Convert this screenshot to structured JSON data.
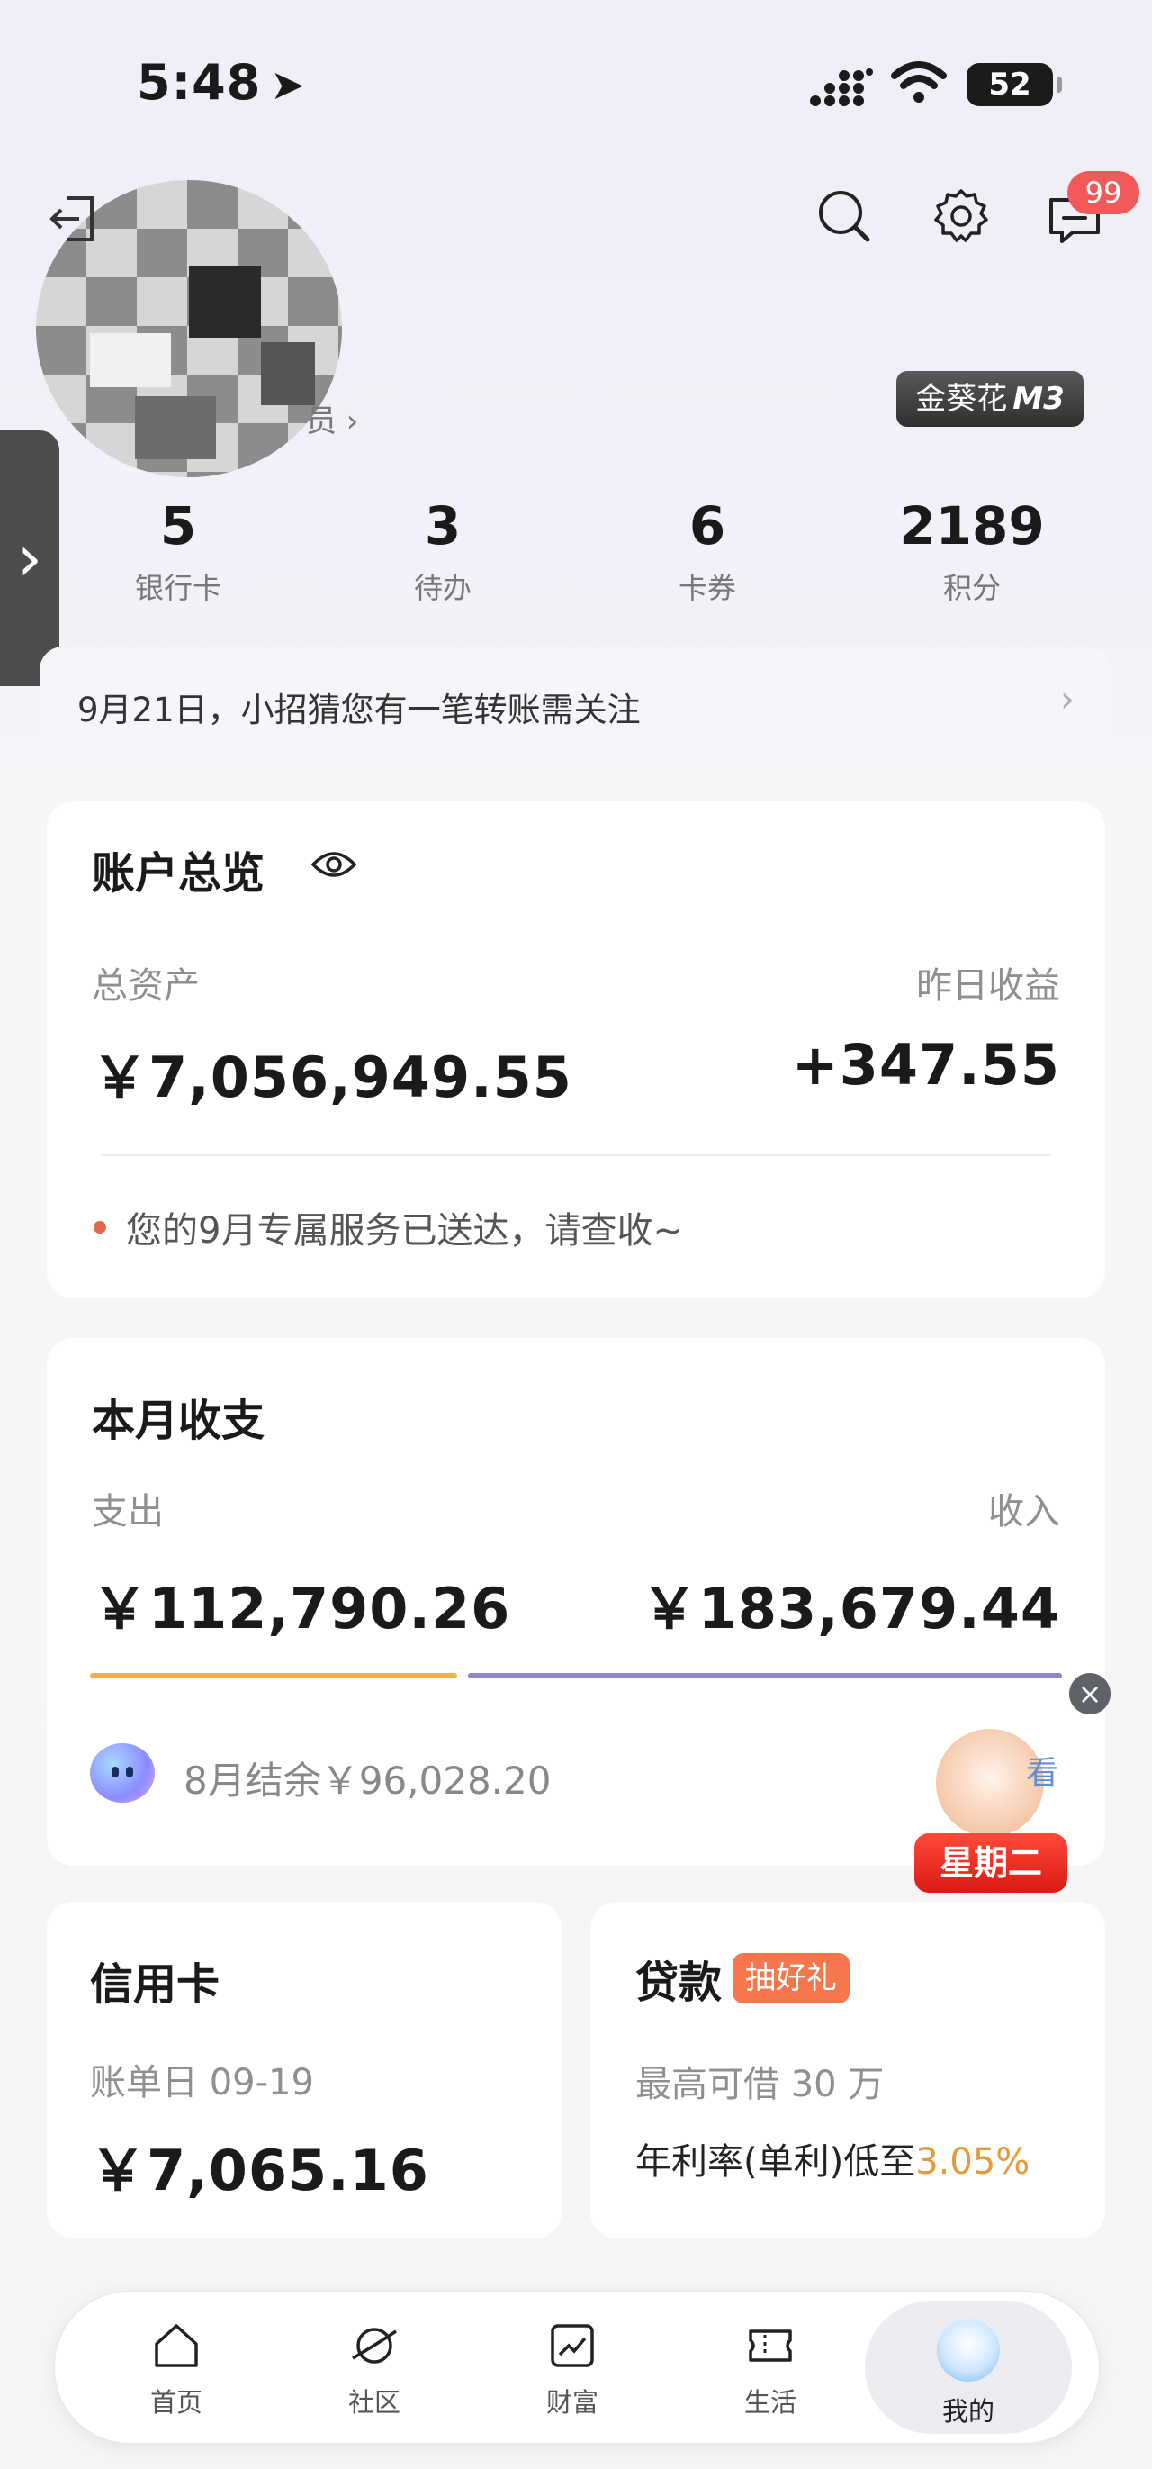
{
  "status": {
    "time": "5:48",
    "battery": "52"
  },
  "header": {
    "name_tail": "员 ›",
    "badge_count": "99",
    "level_badge_prefix": "金葵花",
    "level_badge_level": "M3",
    "side_tab": "›"
  },
  "stats": [
    {
      "value": "5",
      "label": "银行卡"
    },
    {
      "value": "3",
      "label": "待办"
    },
    {
      "value": "6",
      "label": "卡券"
    },
    {
      "value": "2189",
      "label": "积分"
    }
  ],
  "notice": {
    "text": "9月21日，小招猜您有一笔转账需关注",
    "chevron": "›"
  },
  "account_overview": {
    "title": "账户总览",
    "total_assets_label": "总资产",
    "total_assets": "￥7,056,949.55",
    "yesterday_income_label": "昨日收益",
    "yesterday_income": "+347.55",
    "service_notice": "您的9月专属服务已送达，请查收~"
  },
  "monthly": {
    "title": "本月收支",
    "expense_label": "支出",
    "expense": "￥112,790.26",
    "income_label": "收入",
    "income": "￥183,679.44",
    "balance": "8月结余￥96,028.20",
    "promo_tag": "星期二",
    "promo_char": "看",
    "close": "×"
  },
  "credit_card": {
    "title": "信用卡",
    "bill_day": "账单日 09-19",
    "amount": "￥7,065.16"
  },
  "loan": {
    "title": "贷款",
    "tag": "抽好礼",
    "max_borrow": "最高可借 30 万",
    "rate_prefix": "年利率(单利)低至",
    "rate": "3.05%"
  },
  "tabbar": [
    {
      "label": "首页",
      "icon": "home-icon"
    },
    {
      "label": "社区",
      "icon": "planet-icon"
    },
    {
      "label": "财富",
      "icon": "chart-icon"
    },
    {
      "label": "生活",
      "icon": "ticket-icon"
    },
    {
      "label": "我的",
      "icon": "profile-mascot-icon"
    }
  ],
  "colors": {
    "accent_red": "#f25a5a",
    "expense_bar": "#f0b04a",
    "income_bar": "#8d86c9",
    "rate_orange": "#e59a3c",
    "loan_tag": "#f6774b"
  }
}
